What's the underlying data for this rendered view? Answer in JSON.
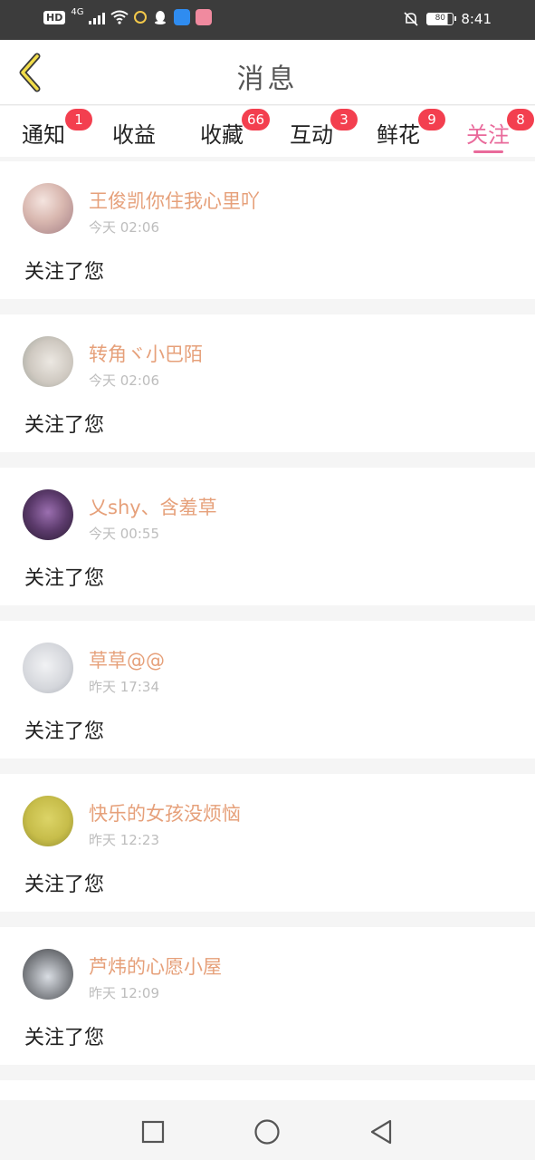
{
  "status_bar": {
    "network_hd": "HD",
    "network_gen": "4G",
    "time": "8:41",
    "battery": "80"
  },
  "header": {
    "title": "消息",
    "back_icon": "chevron-left-icon"
  },
  "tabs": [
    {
      "label": "通知",
      "badge": "1"
    },
    {
      "label": "收益",
      "badge": ""
    },
    {
      "label": "收藏",
      "badge": "66"
    },
    {
      "label": "互动",
      "badge": "3"
    },
    {
      "label": "鲜花",
      "badge": "9"
    },
    {
      "label": "关注",
      "badge": "8",
      "active": true
    }
  ],
  "messages": [
    {
      "name": "王俊凯你住我心里吖",
      "time": "今天 02:06",
      "text": "关注了您",
      "avatar_color": "#d9b8b0"
    },
    {
      "name": "转角ヾ小巴陌",
      "time": "今天 02:06",
      "text": "关注了您",
      "avatar_color": "#cfc9c1"
    },
    {
      "name": "乂shy、含羞草",
      "time": "今天 00:55",
      "text": "关注了您",
      "avatar_color": "#5b3a6b"
    },
    {
      "name": "草草@@",
      "time": "昨天 17:34",
      "text": "关注了您",
      "avatar_color": "#d4d6db"
    },
    {
      "name": "快乐的女孩没烦恼",
      "time": "昨天 12:23",
      "text": "关注了您",
      "avatar_color": "#c7bd4a"
    },
    {
      "name": "芦炜的心愿小屋",
      "time": "昨天 12:09",
      "text": "关注了您",
      "avatar_color": "#8a8d92"
    }
  ],
  "navbar": {
    "recent_icon": "square-icon",
    "home_icon": "circle-icon",
    "back_icon": "triangle-back-icon"
  },
  "colors": {
    "accent": "#e96a9b",
    "name": "#e6a07a",
    "badge": "#f33f4f"
  }
}
